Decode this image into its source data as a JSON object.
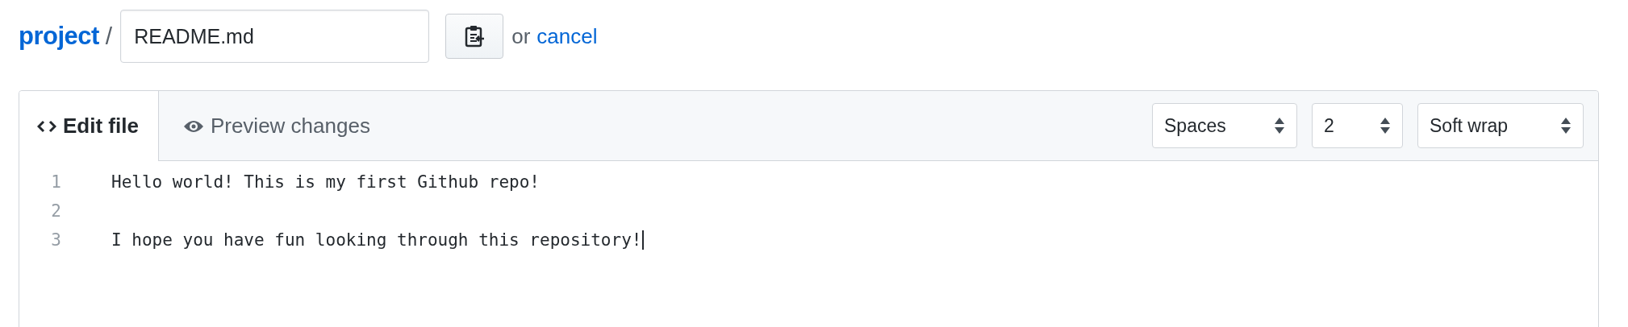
{
  "breadcrumb": {
    "repo_link": "project",
    "separator": "/",
    "filename_field": {
      "value": "README.md"
    },
    "or_text": "or",
    "cancel_link": "cancel"
  },
  "editor": {
    "tabs": [
      {
        "label": "Edit file",
        "kind": "code",
        "selected": true
      },
      {
        "label": "Preview changes",
        "kind": "eye",
        "selected": false
      }
    ],
    "selects": [
      {
        "value": "Spaces"
      },
      {
        "value": "2"
      },
      {
        "value": "Soft wrap"
      }
    ],
    "lines": [
      {
        "number": "1",
        "text": "Hello world! This is my first Github repo!"
      },
      {
        "number": "2"
      },
      {
        "number": "3",
        "text": "I hope you have fun looking through this repository!"
      }
    ]
  }
}
